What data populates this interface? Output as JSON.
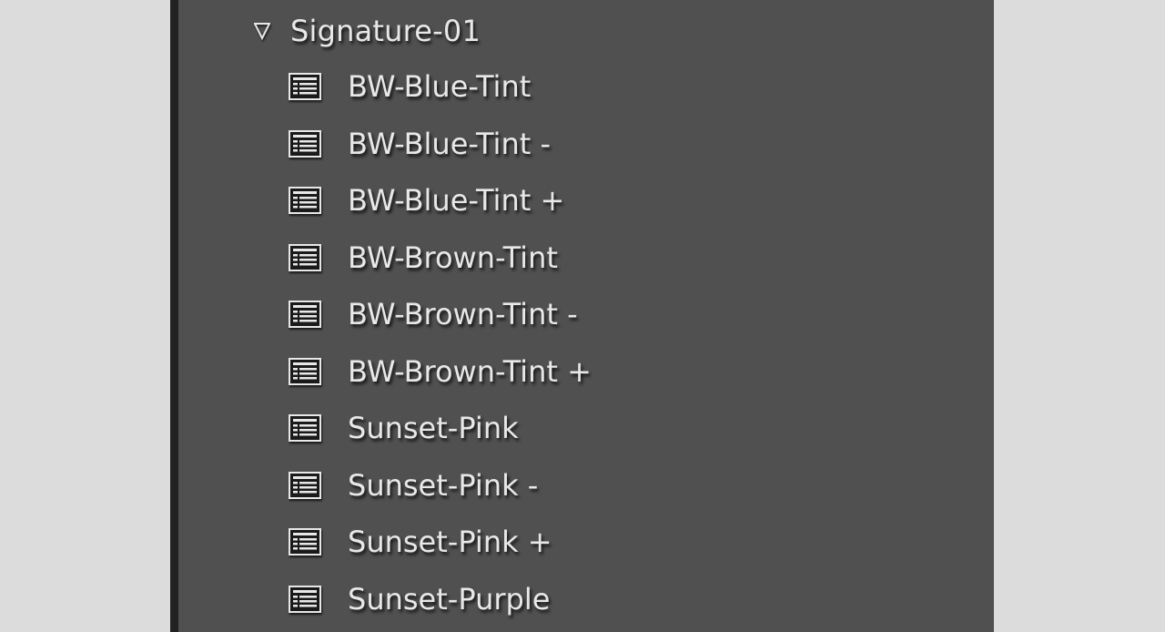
{
  "colors": {
    "page_background": "#dcdcdc",
    "panel_background": "#505050",
    "panel_border": "#222222",
    "text": "#e8e8e8"
  },
  "folder": {
    "label": "Signature-01",
    "expanded": true,
    "icon": "disclosure-triangle-down-icon"
  },
  "presets": [
    {
      "label": "BW-Blue-Tint",
      "icon": "preset-icon"
    },
    {
      "label": "BW-Blue-Tint -",
      "icon": "preset-icon"
    },
    {
      "label": "BW-Blue-Tint +",
      "icon": "preset-icon"
    },
    {
      "label": "BW-Brown-Tint",
      "icon": "preset-icon"
    },
    {
      "label": "BW-Brown-Tint -",
      "icon": "preset-icon"
    },
    {
      "label": "BW-Brown-Tint +",
      "icon": "preset-icon"
    },
    {
      "label": "Sunset-Pink",
      "icon": "preset-icon"
    },
    {
      "label": "Sunset-Pink -",
      "icon": "preset-icon"
    },
    {
      "label": "Sunset-Pink +",
      "icon": "preset-icon"
    },
    {
      "label": "Sunset-Purple",
      "icon": "preset-icon"
    }
  ]
}
